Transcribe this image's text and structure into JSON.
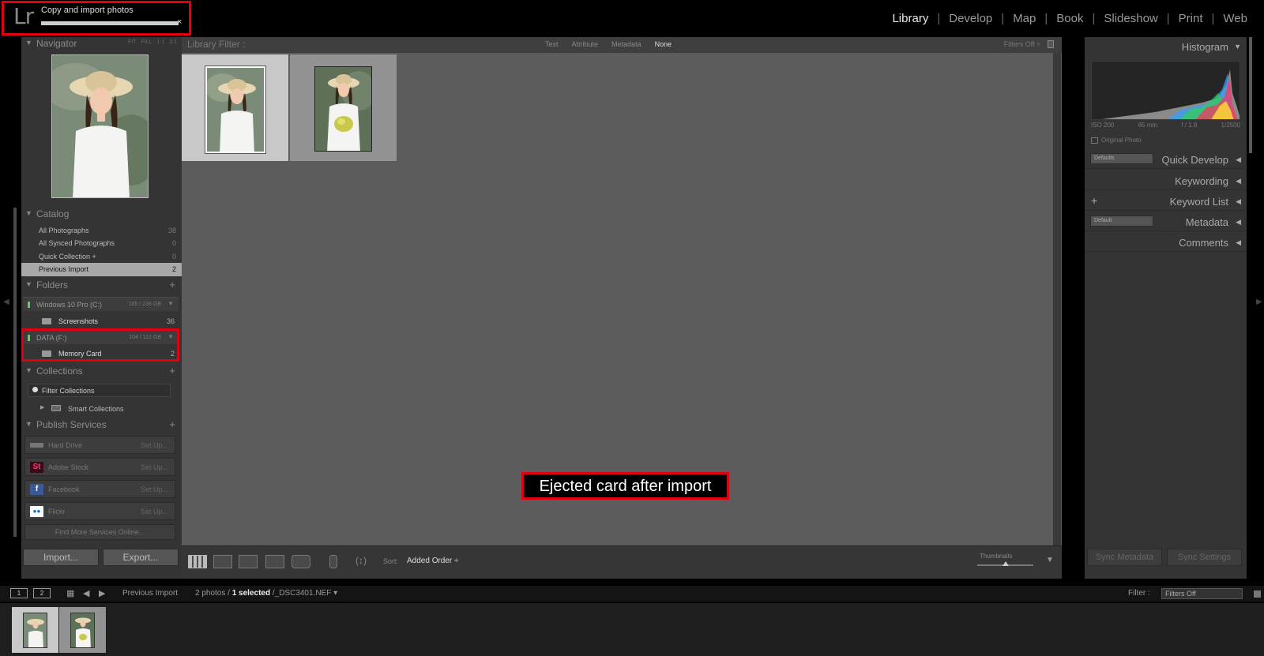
{
  "app": {
    "logo": "Lr"
  },
  "task": {
    "label": "Copy and import photos",
    "progress": 1.0,
    "close": "×"
  },
  "modules": [
    "Library",
    "Develop",
    "Map",
    "Book",
    "Slideshow",
    "Print",
    "Web"
  ],
  "active_module": "Library",
  "navigator": {
    "title": "Navigator",
    "zoom_options": [
      "FIT",
      "FILL",
      "1:1",
      "3:1"
    ]
  },
  "catalog": {
    "title": "Catalog",
    "items": [
      {
        "label": "All Photographs",
        "count": "38"
      },
      {
        "label": "All Synced Photographs",
        "count": "0"
      },
      {
        "label": "Quick Collection +",
        "count": "0"
      },
      {
        "label": "Previous Import",
        "count": "2"
      }
    ]
  },
  "folders": {
    "title": "Folders",
    "plus": "+",
    "volume1": {
      "label": "Windows 10 Pro (C:)",
      "size": "185 / 238 GB"
    },
    "folder1": {
      "label": "Screenshots",
      "count": "36"
    },
    "volume2": {
      "label": "DATA (F:)",
      "size": "104 / 112 GB"
    },
    "folder2": {
      "label": "Memory Card",
      "count": "2"
    }
  },
  "collections": {
    "title": "Collections",
    "plus": "+",
    "filter": "Filter Collections",
    "smart": "Smart Collections"
  },
  "publish": {
    "title": "Publish Services",
    "plus": "+",
    "services": [
      {
        "label": "Hard Drive",
        "setup": "Set Up...",
        "icon": "hard-drive-icon",
        "color": "#777777",
        "glyph": ""
      },
      {
        "label": "Adobe Stock",
        "setup": "Set Up...",
        "icon": "adobe-stock-icon",
        "color": "#3a0a18",
        "glyph": "St"
      },
      {
        "label": "Facebook",
        "setup": "Set Up...",
        "icon": "facebook-icon",
        "color": "#3b5998",
        "glyph": "f"
      },
      {
        "label": "Flickr",
        "setup": "Set Up...",
        "icon": "flickr-icon",
        "color": "#ffffff",
        "glyph": "●●"
      }
    ],
    "find_more": "Find More Services Online..."
  },
  "buttons": {
    "import": "Import...",
    "export": "Export..."
  },
  "library_filter": {
    "label": "Library Filter :",
    "options": [
      "Text",
      "Attribute",
      "Metadata",
      "None"
    ],
    "active": "None",
    "filters_off": "Filters Off ÷"
  },
  "annotation": "Ejected card after import",
  "toolbar": {
    "sort_label": "Sort:",
    "sort_value": "Added Order ÷",
    "thumbnails_label": "Thumbnails",
    "thumbnail_size": 0.5
  },
  "histogram": {
    "title": "Histogram",
    "iso": "ISO 200",
    "focal": "85 mm",
    "aperture": "f / 1.8",
    "shutter": "1/2500",
    "original_photo": "Original Photo"
  },
  "right_panels": {
    "quick_develop": {
      "label": "Quick Develop",
      "preset": "Defaults"
    },
    "keywording": "Keywording",
    "keyword_list": {
      "label": "Keyword List",
      "plus": "+"
    },
    "metadata": {
      "label": "Metadata",
      "preset": "Default"
    },
    "comments": "Comments"
  },
  "sync": {
    "metadata": "Sync Metadata",
    "settings": "Sync Settings"
  },
  "filmstrip": {
    "page1": "1",
    "page2": "2",
    "source": "Previous Import",
    "photo_count": "2 photos /",
    "selected": "1 selected",
    "filename": "/_DSC3401.NEF ▾",
    "filter_label": "Filter :",
    "filter_value": "Filters Off"
  },
  "colors": {
    "accent_red": "#e00010",
    "panel": "#343434",
    "grid_bg": "#5c5c5c"
  }
}
